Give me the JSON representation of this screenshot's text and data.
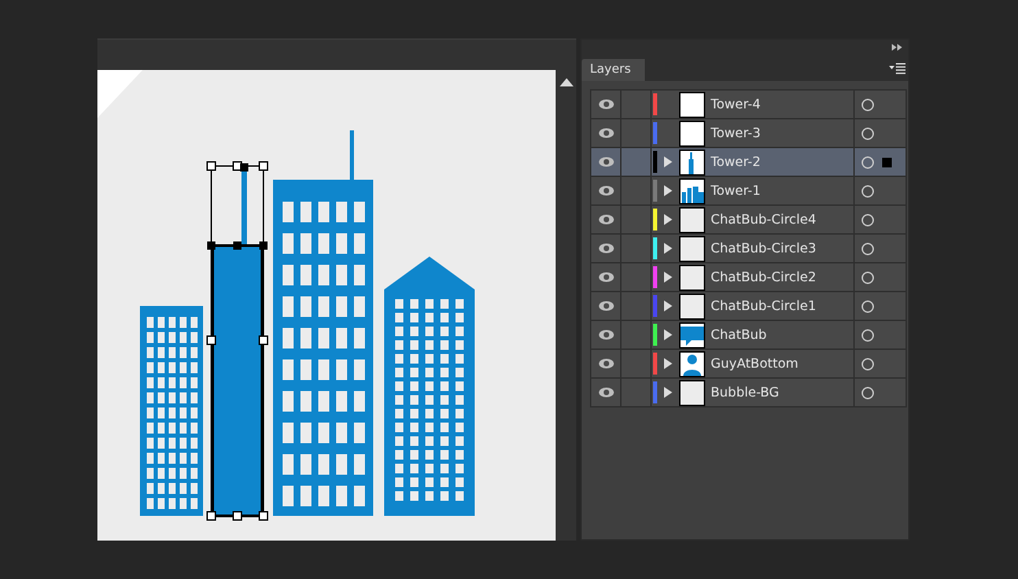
{
  "panel": {
    "tab": "Layers"
  },
  "layers": [
    {
      "name": "Tower-4",
      "color": "#f24848",
      "expandable": false,
      "kind": "blank",
      "visible": true,
      "selected": false
    },
    {
      "name": "Tower-3",
      "color": "#4a6cf0",
      "expandable": false,
      "kind": "blank",
      "visible": true,
      "selected": false
    },
    {
      "name": "Tower-2",
      "color": "#000000",
      "expandable": true,
      "kind": "tower",
      "visible": true,
      "selected": true
    },
    {
      "name": "Tower-1",
      "color": "#7a7a7a",
      "expandable": true,
      "kind": "city",
      "visible": true,
      "selected": false
    },
    {
      "name": "ChatBub-Circle4",
      "color": "#f4f432",
      "expandable": true,
      "kind": "light",
      "visible": true,
      "selected": false
    },
    {
      "name": "ChatBub-Circle3",
      "color": "#3ef0f0",
      "expandable": true,
      "kind": "light",
      "visible": true,
      "selected": false
    },
    {
      "name": "ChatBub-Circle2",
      "color": "#f040f0",
      "expandable": true,
      "kind": "light",
      "visible": true,
      "selected": false
    },
    {
      "name": "ChatBub-Circle1",
      "color": "#4a46f0",
      "expandable": true,
      "kind": "light",
      "visible": true,
      "selected": false
    },
    {
      "name": "ChatBub",
      "color": "#3ef050",
      "expandable": true,
      "kind": "chat",
      "visible": true,
      "selected": false
    },
    {
      "name": "GuyAtBottom",
      "color": "#f24848",
      "expandable": true,
      "kind": "person",
      "visible": true,
      "selected": false
    },
    {
      "name": "Bubble-BG",
      "color": "#4a6cf0",
      "expandable": true,
      "kind": "light",
      "visible": true,
      "selected": false
    }
  ]
}
